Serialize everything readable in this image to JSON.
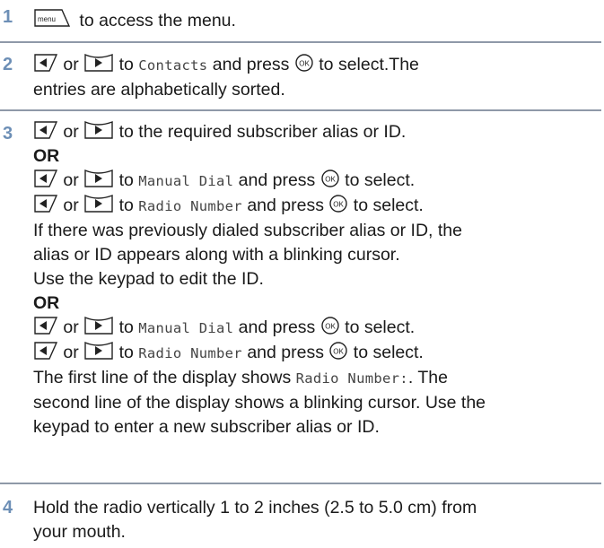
{
  "steps": [
    {
      "number": "1",
      "menu_key": "menu",
      "text": "to access the menu."
    },
    {
      "number": "2",
      "or": "or",
      "to": "to",
      "target": "Contacts",
      "press": "and press",
      "ok": "OK",
      "after_ok": "to select.The",
      "line2": "entries are alphabetically sorted."
    },
    {
      "number": "3",
      "a_text": "to the required subscriber alias or ID.",
      "or_label": "OR",
      "b1_target": "Manual Dial",
      "b2_target": "Radio Number",
      "select": "to select.",
      "b_para1": "If there was previously dialed subscriber alias or ID, the",
      "b_para2": "alias or ID appears along with a blinking cursor.",
      "b_para3": "Use the keypad to edit the ID.",
      "or_label2": "OR",
      "c_para1a": "The first line of the display shows",
      "c_mono": "Radio Number:",
      "c_para1b": ". The",
      "c_para2": "second line of the display shows a blinking cursor. Use the",
      "c_para3": "keypad to enter a new subscriber alias or ID."
    },
    {
      "number": "4",
      "line1": "Hold the radio vertically 1 to 2 inches (2.5 to 5.0 cm) from",
      "line2": "your mouth."
    }
  ]
}
